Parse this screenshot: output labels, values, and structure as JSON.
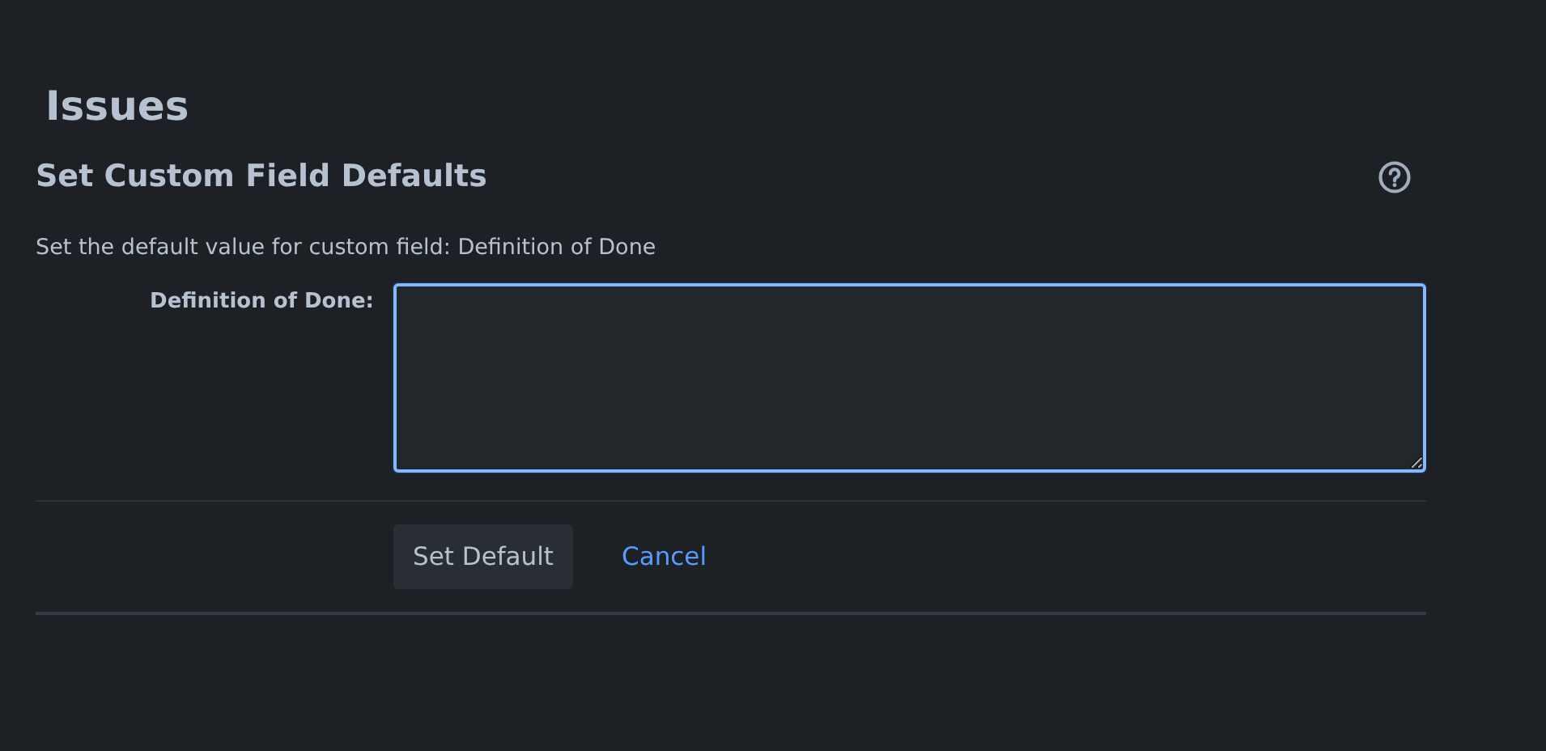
{
  "page_title": "Issues",
  "heading": "Set Custom Field Defaults",
  "description": "Set the default value for custom field: Definition of Done",
  "field": {
    "label": "Definition of Done:",
    "focused": true
  },
  "buttons": [
    {
      "label": "Set Default",
      "kind": "button"
    },
    {
      "label": "Cancel",
      "kind": "link"
    }
  ]
}
